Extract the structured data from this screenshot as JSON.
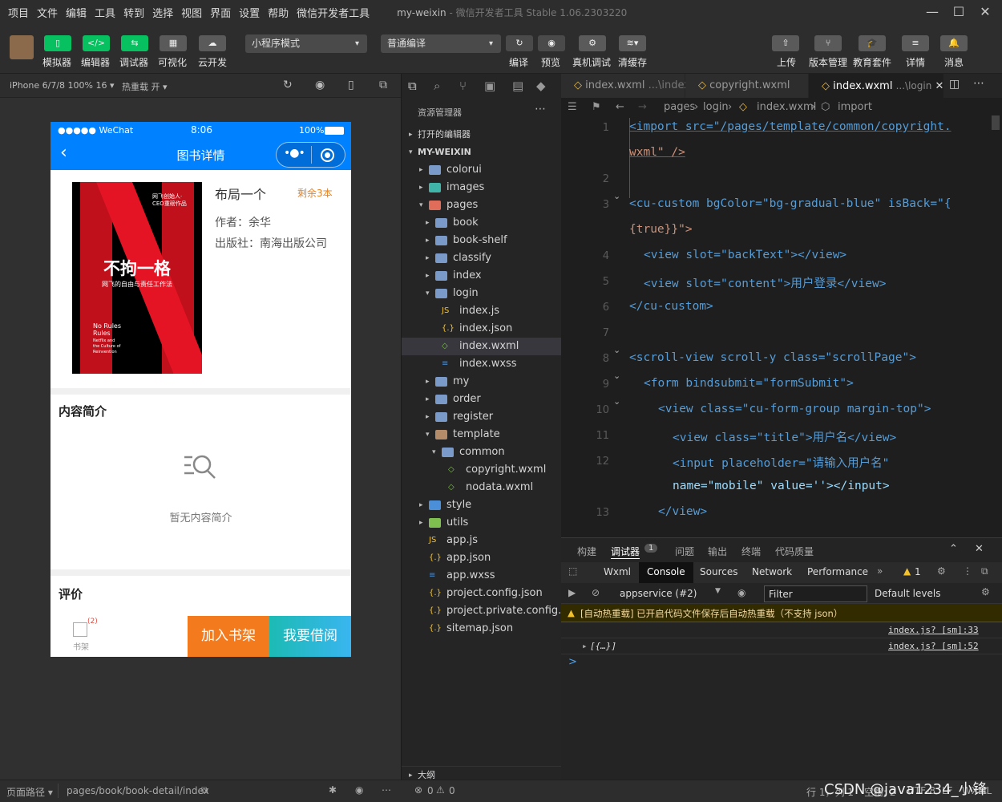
{
  "menu": [
    "项目",
    "文件",
    "编辑",
    "工具",
    "转到",
    "选择",
    "视图",
    "界面",
    "设置",
    "帮助",
    "微信开发者工具"
  ],
  "window_title": "my-weixin",
  "window_sub": " - 微信开发者工具 Stable 1.06.2303220",
  "toolbar": {
    "sim": "模拟器",
    "editor": "编辑器",
    "debugger": "调试器",
    "visual": "可视化",
    "cloud": "云开发",
    "mode": "小程序模式",
    "compile_sel": "普通编译",
    "compile": "编译",
    "preview": "预览",
    "realdebug": "真机调试",
    "cache": "清缓存",
    "upload": "上传",
    "version": "版本管理",
    "edu": "教育套件",
    "detail": "详情",
    "msg": "消息"
  },
  "simbar": {
    "device": "iPhone 6/7/8 100% 16",
    "hotreload": "热重载 开"
  },
  "phone": {
    "signal": "●●●●● WeChat",
    "time": "8:06",
    "battery": "100%",
    "nav_title": "图书详情",
    "book_title": "布局一个",
    "stock": "剩余3本",
    "author": "作者：余华",
    "publisher": "出版社：南海出版公司",
    "cover_big": "不拘一格",
    "cover_sub": "网飞的自由与责任工作法",
    "cover_top": "网飞创始人·\nCEO重磅作品",
    "cover_en": "No Rules\nRules",
    "cover_en2": "Netflix and\nthe Culture of\nReinvention",
    "intro_title": "内容简介",
    "empty_text": "暂无内容简介",
    "review_title": "评价",
    "shelf_label": "书架",
    "shelf_badge": "(2)",
    "btn_add": "加入书架",
    "btn_borrow": "我要借阅"
  },
  "explorer": {
    "title": "资源管理器",
    "open_editors": "打开的编辑器",
    "root": "MY-WEIXIN",
    "outline": "大纲",
    "items": [
      "colorui",
      "images",
      "pages",
      "book",
      "book-shelf",
      "classify",
      "index",
      "login",
      "index.js",
      "index.json",
      "index.wxml",
      "index.wxss",
      "my",
      "order",
      "register",
      "template",
      "common",
      "copyright.wxml",
      "nodata.wxml",
      "style",
      "utils",
      "app.js",
      "app.json",
      "app.wxss",
      "project.config.json",
      "project.private.config.js...",
      "sitemap.json"
    ]
  },
  "editor": {
    "tabs": [
      "index.wxml",
      "...\\index",
      "copyright.wxml",
      "index.wxml",
      "...\\login"
    ],
    "crumbs": [
      "pages",
      "login",
      "index.wxml",
      "import"
    ],
    "line_nums": [
      "1",
      "2",
      "3",
      "4",
      "5",
      "6",
      "7",
      "8",
      "9",
      "10",
      "11",
      "12",
      "13"
    ]
  },
  "code": {
    "l1a": "<import src=\"/pages/template/common/copyright.",
    "l1b": "wxml\" />",
    "l3a": "<cu-custom bgColor=\"bg-gradual-blue\" isBack=\"{",
    "l3b": "{true}}\">",
    "l4": "<view slot=\"backText\"></view>",
    "l5": "<view slot=\"content\">用户登录</view>",
    "l6": "</cu-custom>",
    "l8": "<scroll-view scroll-y class=\"scrollPage\">",
    "l9": "<form bindsubmit=\"formSubmit\">",
    "l10": "<view class=\"cu-form-group margin-top\">",
    "l11": "<view class=\"title\">用户名</view>",
    "l12a": "<input placeholder=\"请输入用户名\"",
    "l12b": "name=\"mobile\" value=''></input>",
    "l13": "</view>"
  },
  "devtools": {
    "tabs": [
      "构建",
      "调试器",
      "问题",
      "输出",
      "终端",
      "代码质量"
    ],
    "badge": "1",
    "subtabs": [
      "Wxml",
      "Console",
      "Sources",
      "Network",
      "Performance"
    ],
    "warn_count": "1",
    "context": "appservice (#2)",
    "filter": "Filter",
    "levels": "Default levels",
    "warn_msg": "[自动热重载] 已开启代码文件保存后自动热重载（不支持 json）",
    "src1": "index.js? [sm]:33",
    "log2": "[{…}]",
    "src2": "index.js? [sm]:52",
    "prompt": ">"
  },
  "statusbar": {
    "path_label": "页面路径",
    "path": "pages/book/book-detail/index",
    "errors": "0",
    "warnings": "0",
    "cursor": "行 1，列 1",
    "spaces": "空格: 2",
    "encoding": "UTF-8",
    "eol": "LF",
    "lang": "WXML",
    "watermark": "CSDN @java1234_小锋"
  },
  "colors": {
    "wechat_blue": "#0081ff",
    "green": "#07c160",
    "orange": "#f37b1d",
    "cyan": "#1cbbb4",
    "stock": "#e6821e"
  }
}
